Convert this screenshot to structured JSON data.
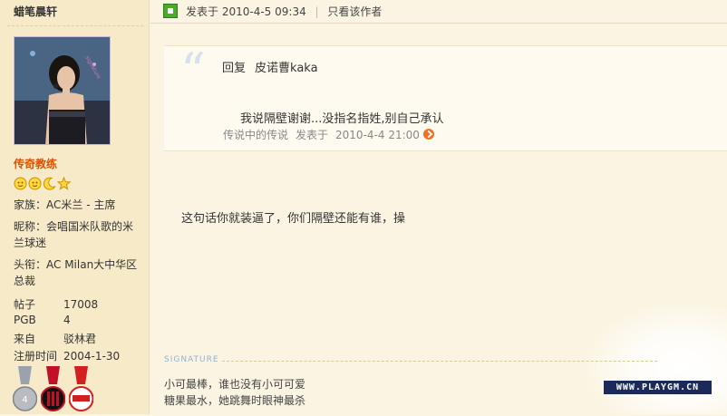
{
  "user": {
    "username": "蜡笔晨轩",
    "rank": "传奇教练",
    "family": "家族：AC米兰 - 主席",
    "nickname": "昵称：会唱国米队歌的米兰球迷",
    "title": "头衔：AC Milan大中华区总裁",
    "stats": [
      {
        "label": "帖子",
        "value": "17008"
      },
      {
        "label": "PGB",
        "value": "4"
      },
      {
        "label": "来自",
        "value": "驳林君"
      },
      {
        "label": "注册时间",
        "value": "2004-1-30"
      }
    ],
    "star_icons": [
      "sun-icon",
      "sun-icon",
      "moon-icon",
      "star-icon"
    ],
    "medals": [
      "silver-medal-icon",
      "ac-milan-medal-icon",
      "arsenal-medal-icon"
    ]
  },
  "post": {
    "posted_label": "发表于",
    "posted_time": "2010-4-5 09:34",
    "only_author": "只看该作者",
    "quote": {
      "reply_label": "回复",
      "reply_to": "皮诺曹kaka",
      "text": "我说隔壁谢谢...没指名指姓,别自己承认",
      "author": "传说中的传说",
      "posted_label": "发表于",
      "time": "2010-4-4 21:00"
    },
    "message": "这句话你就装逼了，你们隔壁还能有谁，操",
    "signature_label": "SIGNATURE",
    "signature_lines": [
      "小可最棒，谁也没有小可可爱",
      "糖果最水，她跳舞时眼神最杀"
    ]
  },
  "watermark": "WWW.PLAYGM.CN",
  "colors": {
    "rank": "#e05000",
    "accent_green": "#4caa2a",
    "background": "#fbf4e2"
  }
}
